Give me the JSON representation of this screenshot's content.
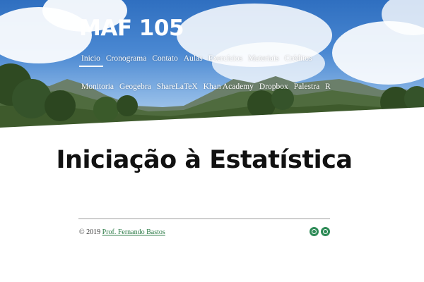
{
  "site": {
    "title": "MAF 105"
  },
  "nav": {
    "primary": [
      {
        "label": "Inicio",
        "active": true
      },
      {
        "label": "Cronograma"
      },
      {
        "label": "Contato"
      },
      {
        "label": "Aulas"
      },
      {
        "label": "Exercícios"
      },
      {
        "label": "Materiais"
      },
      {
        "label": "Créditos"
      }
    ],
    "secondary": [
      {
        "label": "Monitoria"
      },
      {
        "label": "Geogebra"
      },
      {
        "label": "ShareLaTeX"
      },
      {
        "label": "Khan Academy"
      },
      {
        "label": "Dropbox"
      },
      {
        "label": "Palestra"
      },
      {
        "label": "R"
      }
    ]
  },
  "main": {
    "title": "Iniciação à Estatística"
  },
  "footer": {
    "copyright": "© 2019 ",
    "author_link": "Prof. Fernando Bastos",
    "social_icons": [
      "social-circle-icon",
      "social-circle-icon"
    ]
  },
  "colors": {
    "accent": "#2e8b57",
    "sky": "#4a88d2",
    "text": "#111111"
  }
}
